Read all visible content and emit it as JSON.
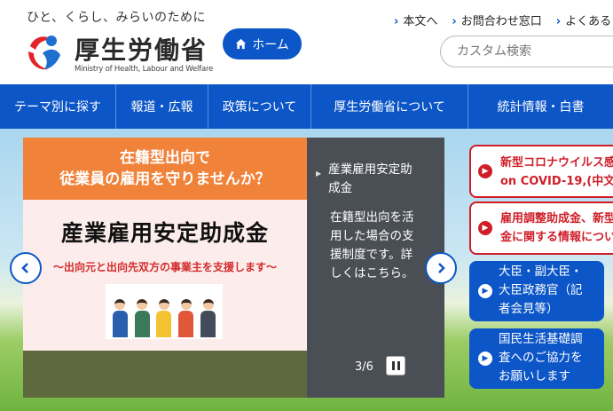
{
  "header": {
    "tagline": "ひと、くらし、みらいのために",
    "logo_ja": "厚生労働省",
    "logo_en": "Ministry of Health, Labour and Welfare",
    "home_label": "ホーム",
    "utility_links": [
      "本文へ",
      "お問合わせ窓口",
      "よくある"
    ],
    "search_placeholder": "カスタム検索"
  },
  "nav": {
    "items": [
      "テーマ別に探す",
      "報道・広報",
      "政策について",
      "厚生労働省について",
      "統計情報・白書"
    ]
  },
  "carousel": {
    "slide_header_line1": "在籍型出向で",
    "slide_header_line2": "従業員の雇用を守りませんか？",
    "slide_title": "産業雇用安定助成金",
    "slide_subtitle": "〜出向元と出向先双方の事業主を支援します〜",
    "caption_title_line1": "産業雇用安定助",
    "caption_title_line2": "成金",
    "caption_body": [
      "在籍型出向を活",
      "用した場合の支",
      "援制度です。詳",
      "しくはこちら。"
    ],
    "counter": "3/6"
  },
  "right_panel": {
    "cards": [
      {
        "line1": "新型コロナウイルス感",
        "line2": "on COVID-19,(中文"
      },
      {
        "line1": "雇用調整助成金、新型",
        "line2": "金に関する情報につい"
      },
      {
        "line1": "大臣・副大臣・",
        "line2": "大臣政務官（記",
        "line3": "者会見等）"
      },
      {
        "line1": "国民生活基礎調",
        "line2": "査へのご協力を",
        "line3": "お願いします"
      }
    ]
  },
  "colors": {
    "brand_blue": "#0c56c8",
    "alert_red": "#cf1e28",
    "banner_orange": "#f0823a"
  },
  "icons": [
    "home-icon",
    "chevron-left-icon",
    "chevron-right-icon",
    "pause-icon",
    "play-circle-icon"
  ]
}
